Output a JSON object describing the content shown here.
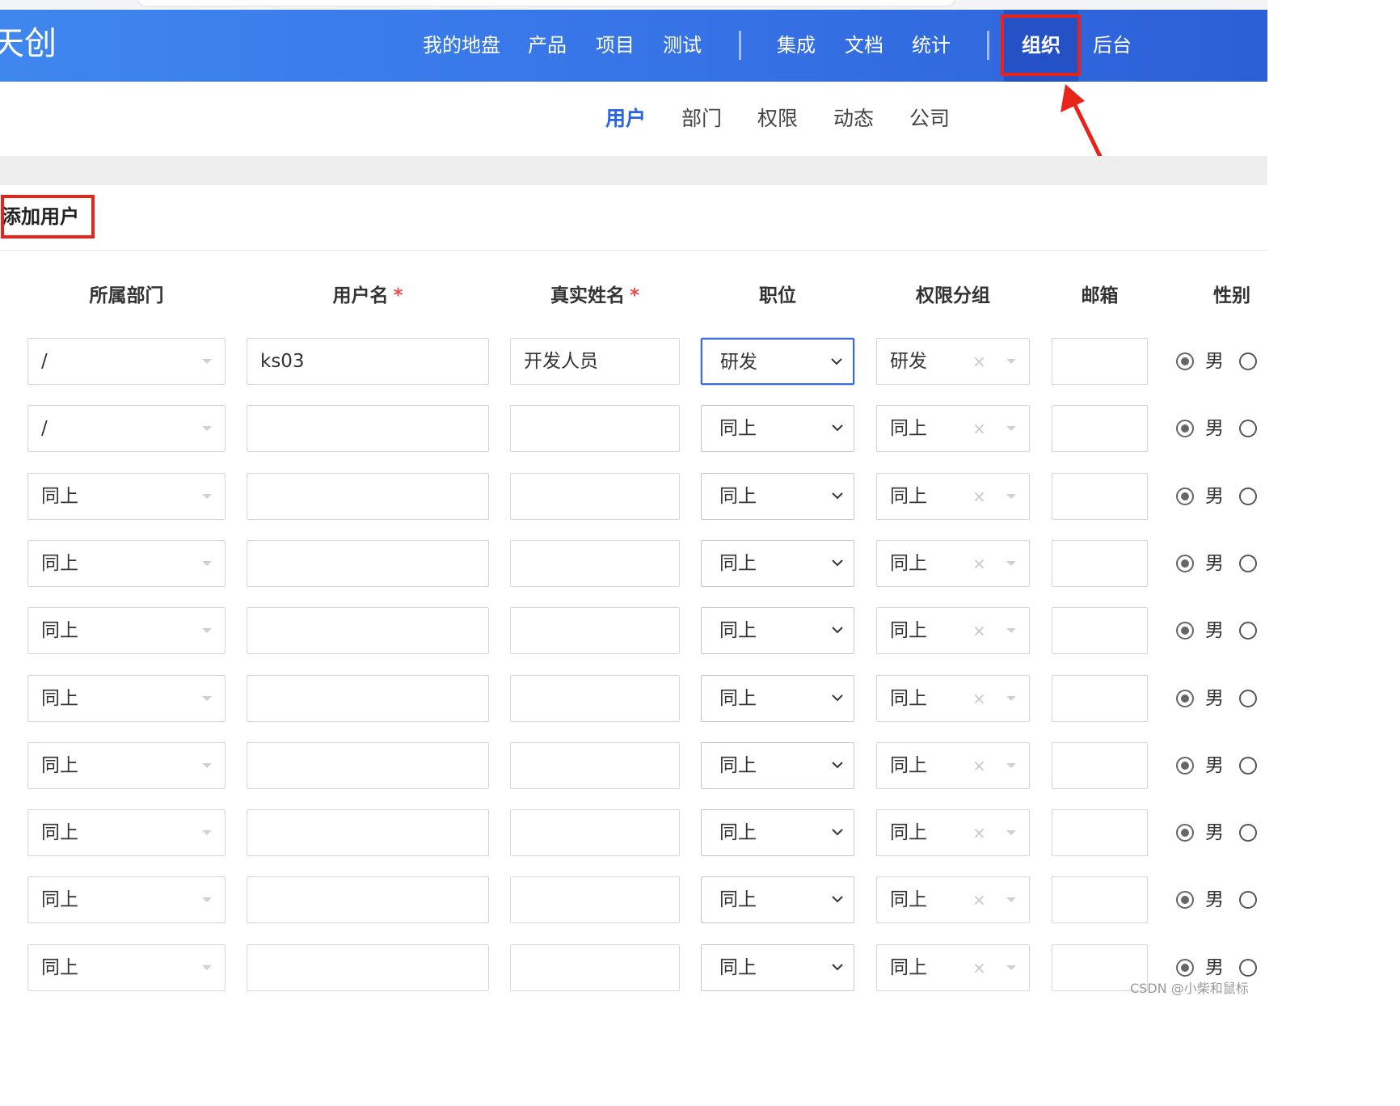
{
  "app": {
    "logo_text": "天创"
  },
  "nav": {
    "items": [
      "我的地盘",
      "产品",
      "项目",
      "测试",
      "集成",
      "文档",
      "统计",
      "组织",
      "后台"
    ],
    "active": "组织"
  },
  "subnav": {
    "items": [
      "用户",
      "部门",
      "权限",
      "动态",
      "公司"
    ],
    "active": "用户"
  },
  "page": {
    "title": "添加用户"
  },
  "table": {
    "headers": {
      "dept": "所属部门",
      "username": "用户名",
      "realname": "真实姓名",
      "position": "职位",
      "group": "权限分组",
      "email": "邮箱",
      "gender": "性别"
    },
    "required_mark": "*",
    "gender_label": "男",
    "clear_symbol": "×",
    "rows": [
      {
        "dept": "/",
        "username": "ks03",
        "realname": "开发人员",
        "position": "研发",
        "group": "研发",
        "email": ""
      },
      {
        "dept": "/",
        "username": "",
        "realname": "",
        "position": "同上",
        "group": "同上",
        "email": ""
      },
      {
        "dept": "同上",
        "username": "",
        "realname": "",
        "position": "同上",
        "group": "同上",
        "email": ""
      },
      {
        "dept": "同上",
        "username": "",
        "realname": "",
        "position": "同上",
        "group": "同上",
        "email": ""
      },
      {
        "dept": "同上",
        "username": "",
        "realname": "",
        "position": "同上",
        "group": "同上",
        "email": ""
      },
      {
        "dept": "同上",
        "username": "",
        "realname": "",
        "position": "同上",
        "group": "同上",
        "email": ""
      },
      {
        "dept": "同上",
        "username": "",
        "realname": "",
        "position": "同上",
        "group": "同上",
        "email": ""
      },
      {
        "dept": "同上",
        "username": "",
        "realname": "",
        "position": "同上",
        "group": "同上",
        "email": ""
      },
      {
        "dept": "同上",
        "username": "",
        "realname": "",
        "position": "同上",
        "group": "同上",
        "email": ""
      },
      {
        "dept": "同上",
        "username": "",
        "realname": "",
        "position": "同上",
        "group": "同上",
        "email": ""
      }
    ]
  },
  "watermark": "CSDN @小柴和鼠标",
  "colors": {
    "header": "#3673e6",
    "accent": "#2a64e6",
    "highlight": "#e8231a"
  }
}
